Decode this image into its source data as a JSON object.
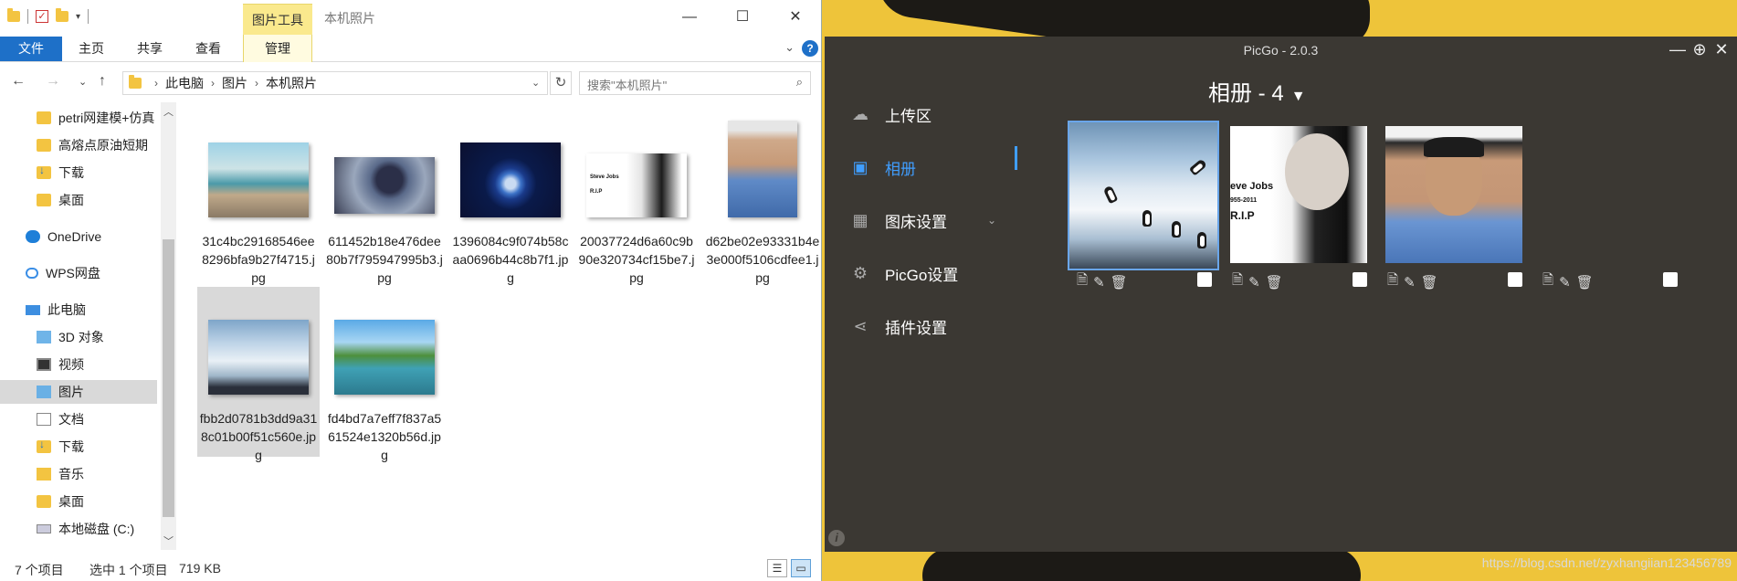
{
  "explorer": {
    "title": "本机照片",
    "contextual_tab": "图片工具",
    "ribbon_tabs": [
      "文件",
      "主页",
      "共享",
      "查看",
      "管理"
    ],
    "breadcrumb": [
      "此电脑",
      "图片",
      "本机照片"
    ],
    "search_placeholder": "搜索\"本机照片\"",
    "nav_items": [
      {
        "label": "petri网建模+仿真",
        "icon": "folder-icon"
      },
      {
        "label": "高熔点原油短期",
        "icon": "folder-icon"
      },
      {
        "label": "下载",
        "icon": "download-icon"
      },
      {
        "label": "桌面",
        "icon": "folder-icon"
      },
      {
        "label": "OneDrive",
        "icon": "cloud-icon"
      },
      {
        "label": "WPS网盘",
        "icon": "wps-cloud-icon"
      },
      {
        "label": "此电脑",
        "icon": "computer-icon"
      },
      {
        "label": "3D 对象",
        "icon": "3d-objects-icon"
      },
      {
        "label": "视频",
        "icon": "video-icon"
      },
      {
        "label": "图片",
        "icon": "pictures-icon"
      },
      {
        "label": "文档",
        "icon": "document-icon"
      },
      {
        "label": "下载",
        "icon": "download-icon"
      },
      {
        "label": "音乐",
        "icon": "music-icon"
      },
      {
        "label": "桌面",
        "icon": "folder-icon"
      },
      {
        "label": "本地磁盘 (C:)",
        "icon": "drive-icon"
      }
    ],
    "files": [
      {
        "name": "31c4bc29168546ee8296bfa9b27f4715.jpg",
        "thumb": "beach"
      },
      {
        "name": "611452b18e476dee80b7f795947995b3.jpg",
        "thumb": "art"
      },
      {
        "name": "1396084c9f074b58caa0696b44c8b7f1.jpg",
        "thumb": "earth"
      },
      {
        "name": "20037724d6a60c9b90e320734cf15be7.jpg",
        "thumb": "jobs"
      },
      {
        "name": "d62be02e93331b4e3e000f5106cdfee1.jpg",
        "thumb": "cop"
      },
      {
        "name": "fbb2d0781b3dd9a318c01b00f51c560e.jpg",
        "thumb": "penguins"
      },
      {
        "name": "fd4bd7a7eff7f837a561524e1320b56d.jpg",
        "thumb": "lake"
      }
    ],
    "status": {
      "count": "7 个项目",
      "selection": "选中 1 个项目",
      "size": "719 KB"
    }
  },
  "picgo": {
    "title": "PicGo - 2.0.3",
    "menu": [
      {
        "label": "上传区",
        "icon": "cloud-upload-icon"
      },
      {
        "label": "相册",
        "icon": "picture-icon"
      },
      {
        "label": "图床设置",
        "icon": "grid-icon"
      },
      {
        "label": "PicGo设置",
        "icon": "settings-icon"
      },
      {
        "label": "插件设置",
        "icon": "share-icon"
      }
    ],
    "album_title": "相册 - 4",
    "jobs_text": "eve Jobs",
    "jobs_dates": "955-2011",
    "jobs_rip": "R.I.P",
    "thumb_jobs_name": "Steve Jobs",
    "thumb_jobs_rip": "R.I.P"
  },
  "watermark": "https://blog.csdn.net/zyxhangiian123456789",
  "colors": {
    "accent_blue": "#409eff",
    "explorer_file_tab": "#1e70c8",
    "picgo_bg": "#3b3833",
    "desktop_yellow": "#eec43a"
  }
}
